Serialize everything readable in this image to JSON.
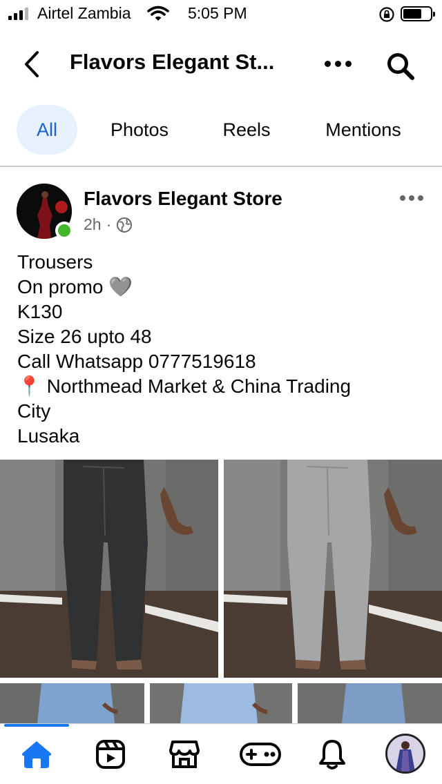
{
  "status_bar": {
    "carrier": "Airtel Zambia",
    "time": "5:05 PM",
    "battery_level": 0.6
  },
  "header": {
    "title": "Flavors Elegant St..."
  },
  "tabs": [
    {
      "label": "All",
      "active": true
    },
    {
      "label": "Photos",
      "active": false
    },
    {
      "label": "Reels",
      "active": false
    },
    {
      "label": "Mentions",
      "active": false
    }
  ],
  "post": {
    "author": "Flavors Elegant Store",
    "time": "2h",
    "separator": "·",
    "privacy_icon": "globe-icon",
    "lines": [
      "Trousers",
      "On promo 🩶",
      "K130",
      "Size 26 upto 48",
      "Call Whatsapp 0777519618",
      "📍 Northmead Market & China Trading",
      "City",
      "Lusaka"
    ],
    "photos": [
      {
        "subject": "dark-grey-jeans"
      },
      {
        "subject": "light-grey-jeans"
      },
      {
        "subject": "light-blue-jeans"
      },
      {
        "subject": "light-blue-jeans"
      },
      {
        "subject": "blue-jeans-back"
      }
    ]
  },
  "bottom_nav": [
    {
      "name": "home-icon",
      "active": true
    },
    {
      "name": "video-icon",
      "active": false
    },
    {
      "name": "marketplace-icon",
      "active": false
    },
    {
      "name": "gaming-icon",
      "active": false
    },
    {
      "name": "notifications-icon",
      "active": false
    },
    {
      "name": "profile-avatar",
      "active": false
    }
  ],
  "colors": {
    "accent": "#1877f2",
    "active_tab_bg": "#e7f0fd",
    "active_tab_text": "#1763cf",
    "online": "#42b72a",
    "secondary_text": "#65676b"
  }
}
